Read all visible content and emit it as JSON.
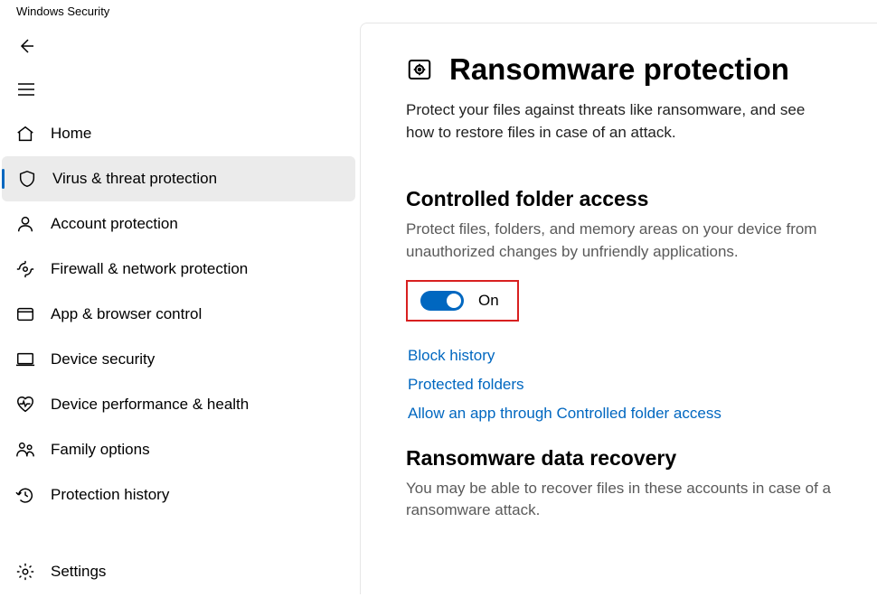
{
  "window_title": "Windows Security",
  "nav": [
    {
      "key": "home",
      "label": "Home",
      "selected": false
    },
    {
      "key": "virus",
      "label": "Virus & threat protection",
      "selected": true
    },
    {
      "key": "account",
      "label": "Account protection",
      "selected": false
    },
    {
      "key": "firewall",
      "label": "Firewall & network protection",
      "selected": false
    },
    {
      "key": "appbrowser",
      "label": "App & browser control",
      "selected": false
    },
    {
      "key": "device",
      "label": "Device security",
      "selected": false
    },
    {
      "key": "perf",
      "label": "Device performance & health",
      "selected": false
    },
    {
      "key": "family",
      "label": "Family options",
      "selected": false
    },
    {
      "key": "history",
      "label": "Protection history",
      "selected": false
    }
  ],
  "settings_label": "Settings",
  "page": {
    "title": "Ransomware protection",
    "subtitle": "Protect your files against threats like ransomware, and see how to restore files in case of an attack."
  },
  "controlled_folder": {
    "title": "Controlled folder access",
    "desc": "Protect files, folders, and memory areas on your device from unauthorized changes by unfriendly applications.",
    "toggle_state": "On",
    "links": [
      "Block history",
      "Protected folders",
      "Allow an app through Controlled folder access"
    ]
  },
  "recovery": {
    "title": "Ransomware data recovery",
    "desc": "You may be able to recover files in these accounts in case of a ransomware attack."
  }
}
